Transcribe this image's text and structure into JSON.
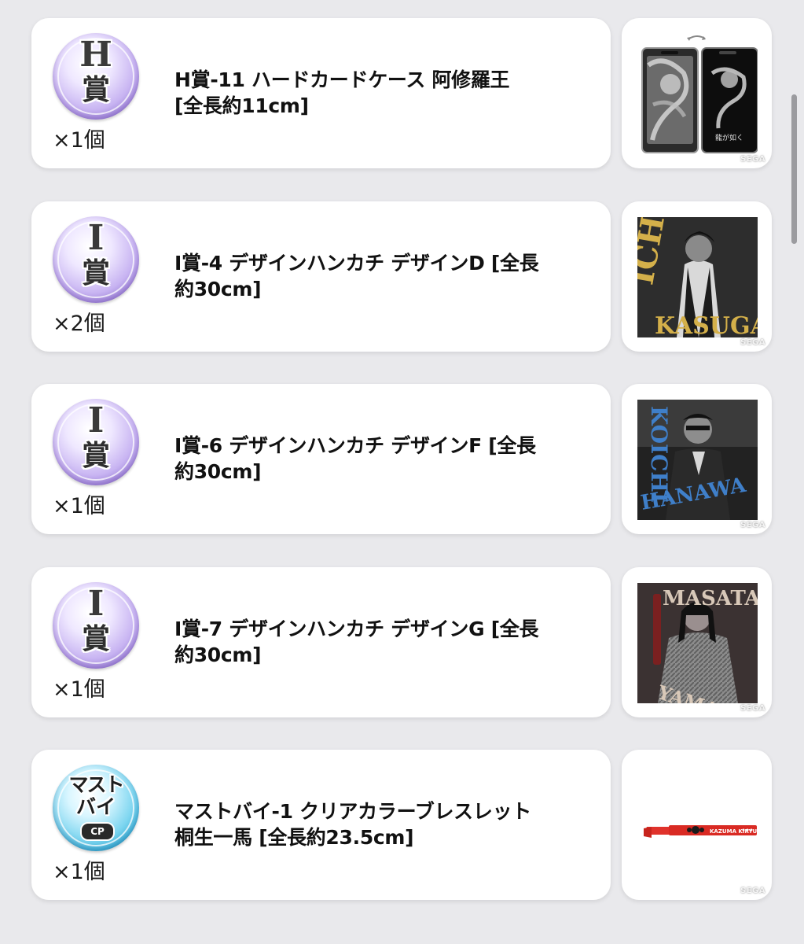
{
  "items": [
    {
      "badge": {
        "letter": "H",
        "kanji": "賞"
      },
      "title_line1": "H賞-11 ハードカードケース 阿修羅王",
      "title_line2": "[全長約11cm]",
      "quantity": "×1個",
      "thumbnail": {
        "icon": "card-case-image",
        "watermark": "SEGA"
      }
    },
    {
      "badge": {
        "letter": "I",
        "kanji": "賞"
      },
      "title_line1": "I賞-4 デザインハンカチ デザインD [全長",
      "title_line2": "約30cm]",
      "quantity": "×2個",
      "thumbnail": {
        "icon": "handkerchief-image",
        "text_top": "ICHIBAN",
        "text_bottom": "KASUGA",
        "watermark": "SEGA"
      }
    },
    {
      "badge": {
        "letter": "I",
        "kanji": "賞"
      },
      "title_line1": "I賞-6 デザインハンカチ デザインF [全長",
      "title_line2": "約30cm]",
      "quantity": "×1個",
      "thumbnail": {
        "icon": "handkerchief-image",
        "text_top": "KOICHI",
        "text_bottom": "HANAWA",
        "watermark": "SEGA"
      }
    },
    {
      "badge": {
        "letter": "I",
        "kanji": "賞"
      },
      "title_line1": "I賞-7 デザインハンカチ デザインG [全長",
      "title_line2": "約30cm]",
      "quantity": "×1個",
      "thumbnail": {
        "icon": "handkerchief-image",
        "text_top": "MASATAKA",
        "text_bottom": "YAMAI",
        "watermark": "SEGA"
      }
    },
    {
      "badge": {
        "line1": "マスト",
        "line2": "バイ",
        "tag": "CP"
      },
      "title_line1": "マストバイ-1 クリアカラーブレスレット",
      "title_line2": "桐生一馬 [全長約23.5cm]",
      "quantity": "×1個",
      "thumbnail": {
        "icon": "bracelet-image",
        "band_text": "KAZUMA KIRYU",
        "watermark": "SEGA"
      }
    }
  ],
  "colors": {
    "background": "#e9e9ec",
    "card": "#ffffff",
    "badge_purple": "#a38bdc",
    "badge_cyan": "#36b3db",
    "bracelet_red": "#e0322b"
  }
}
